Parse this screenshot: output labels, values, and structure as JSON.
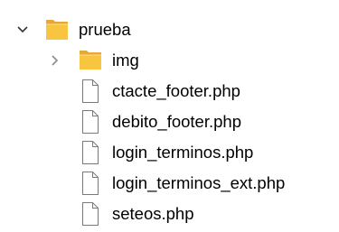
{
  "tree": {
    "root": {
      "label": "prueba",
      "icon": "folder-icon",
      "expanded": true,
      "chevron_icon": "chevron-down-icon",
      "folder_color": "#F8C540"
    },
    "children": [
      {
        "label": "img",
        "type": "folder",
        "icon": "folder-icon",
        "expanded": false,
        "chevron_icon": "chevron-right-icon"
      },
      {
        "label": "ctacte_footer.php",
        "type": "file",
        "icon": "file-icon"
      },
      {
        "label": "debito_footer.php",
        "type": "file",
        "icon": "file-icon"
      },
      {
        "label": "login_terminos.php",
        "type": "file",
        "icon": "file-icon"
      },
      {
        "label": "login_terminos_ext.php",
        "type": "file",
        "icon": "file-icon"
      },
      {
        "label": "seteos.php",
        "type": "file",
        "icon": "file-icon"
      }
    ]
  }
}
